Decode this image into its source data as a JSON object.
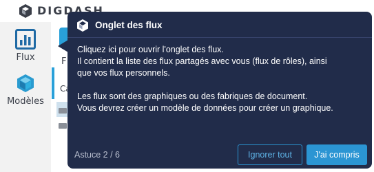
{
  "app": {
    "logo_text": "DIGDASH"
  },
  "sidebar": {
    "items": [
      {
        "label": "Flux",
        "icon": "bar-chart-icon"
      },
      {
        "label": "Modèles",
        "icon": "cube-icon"
      }
    ]
  },
  "background": {
    "tab_letter": "F",
    "column_partial": "Ca"
  },
  "tooltip": {
    "title": "Onglet des flux",
    "icon": "cube-icon",
    "body": [
      "Cliquez ici pour ouvrir l'onglet des flux.",
      "Il contient la liste des flux partagés avec vous (flux de rôles), ainsi",
      "que vos flux personnels.",
      "Les flux sont des graphiques ou des fabriques de document.",
      "Vous devrez créer un modèle de données pour créer un graphique."
    ],
    "step": "Astuce 2 / 6",
    "ignore_label": "Ignorer tout",
    "ok_label": "J'ai compris"
  },
  "colors": {
    "tooltip_bg": "#212c4a",
    "accent": "#2b95d3",
    "sidebar_bg": "#f2f2f2"
  }
}
